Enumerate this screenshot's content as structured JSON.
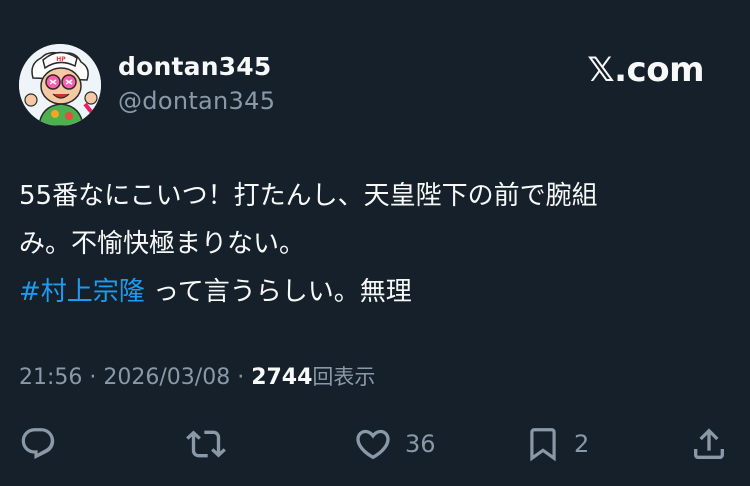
{
  "author": {
    "display_name": "dontan345",
    "handle": "@dontan345"
  },
  "brand": "𝕏.com",
  "body": {
    "line1": "55番なにこいつ！打たんし、天皇陛下の前で腕組",
    "line2": "み。不愉快極まりない。",
    "hashtag": "#村上宗隆",
    "line3_rest": " って言うらしい。無理"
  },
  "meta": {
    "time": "21:56",
    "separator1": " · ",
    "date": "2026/03/08",
    "separator2": " · ",
    "views_count": "2744",
    "views_label": "回表示"
  },
  "actions": {
    "reply_count": "",
    "retweet_count": "",
    "like_count": "36",
    "bookmark_count": "2"
  },
  "icons": {
    "reply": "reply-icon",
    "retweet": "retweet-icon",
    "like": "heart-icon",
    "bookmark": "bookmark-icon",
    "share": "share-icon"
  },
  "colors": {
    "background": "#15202b",
    "text": "#f7f9f9",
    "secondary": "#8b98a5",
    "link": "#1d9bf0"
  }
}
